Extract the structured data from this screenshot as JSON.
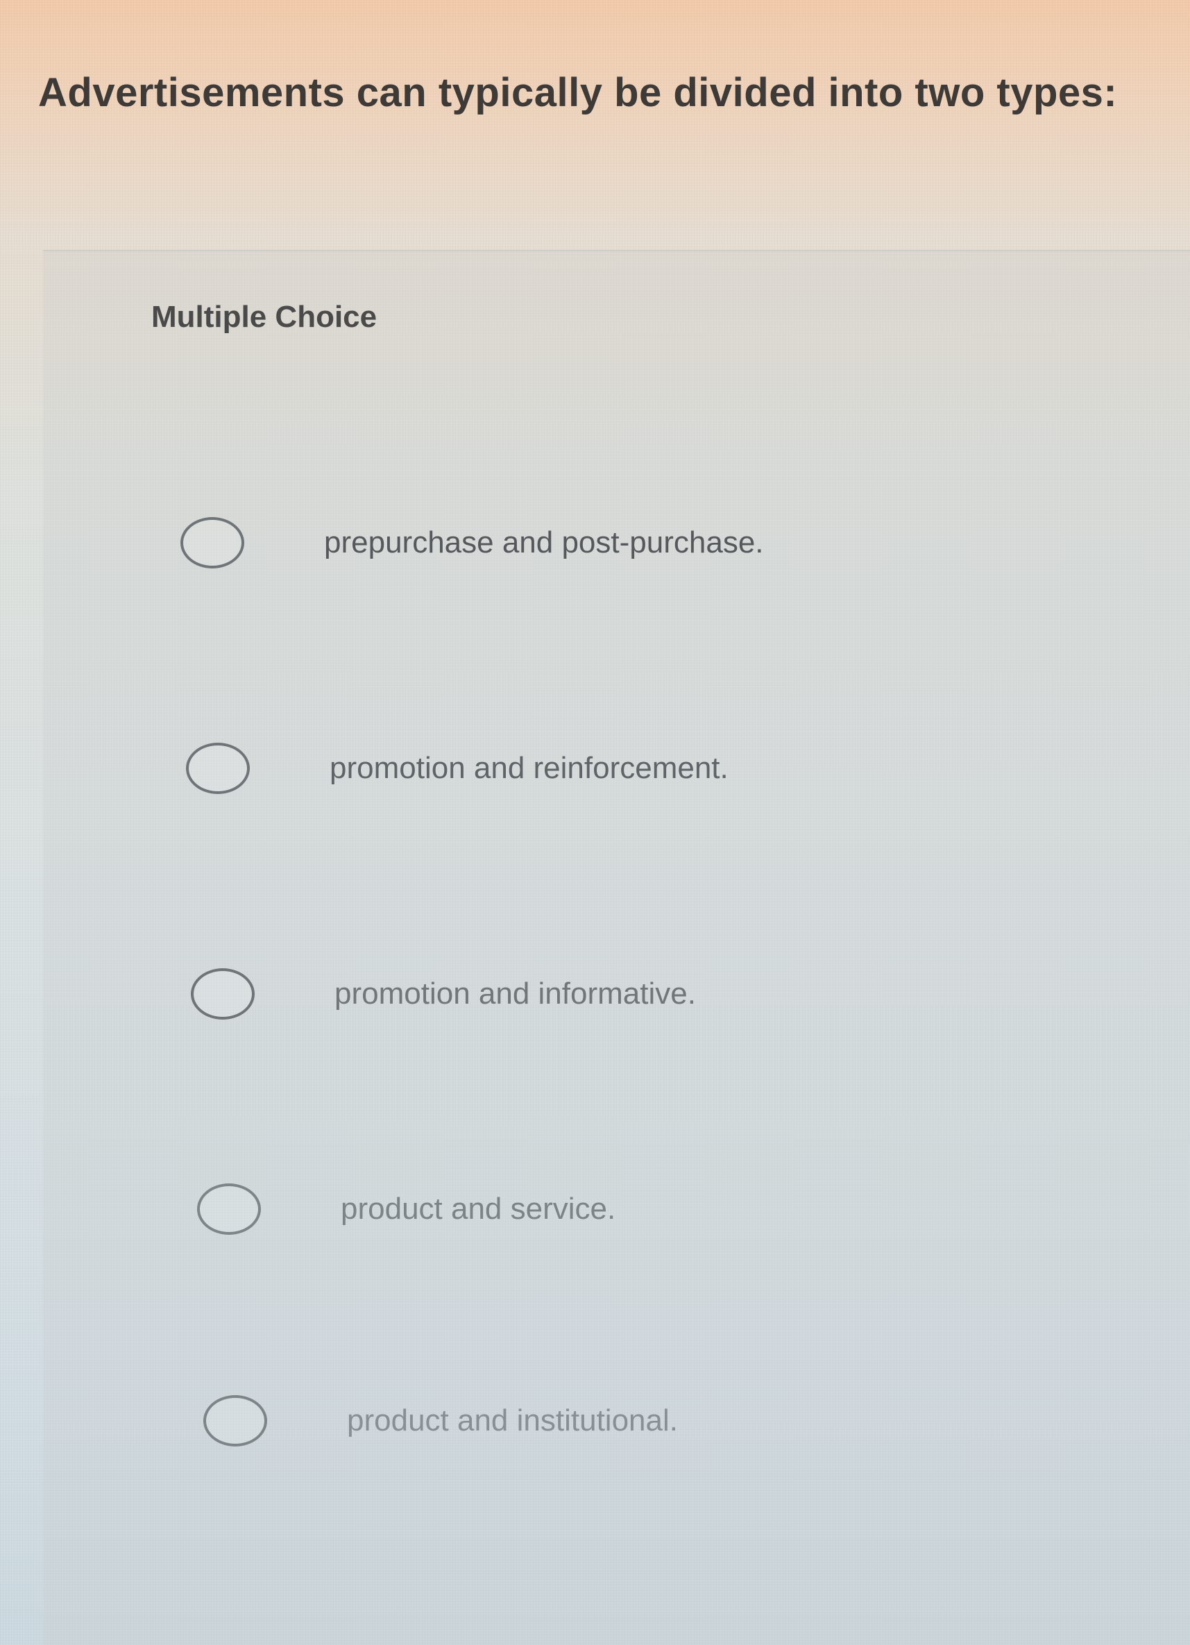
{
  "question": {
    "text": "Advertisements can typically be divided into two types:"
  },
  "question_type": "Multiple Choice",
  "options": [
    {
      "label": "prepurchase and post-purchase.",
      "selected": false
    },
    {
      "label": "promotion and reinforcement.",
      "selected": false
    },
    {
      "label": "promotion and informative.",
      "selected": false
    },
    {
      "label": "product and service.",
      "selected": false
    },
    {
      "label": "product and institutional.",
      "selected": false
    }
  ]
}
